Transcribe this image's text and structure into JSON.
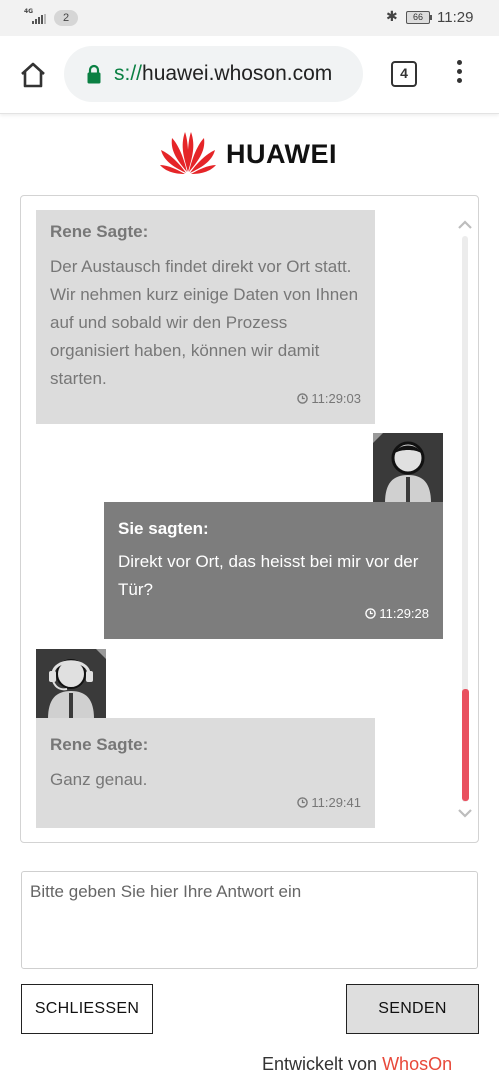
{
  "status_bar": {
    "network": "4G",
    "notification_count": "2",
    "battery": "66",
    "time": "11:29"
  },
  "browser": {
    "url_scheme": "s://",
    "url_host": "huawei.whoson.com",
    "tab_count": "4"
  },
  "logo": {
    "text": "HUAWEI",
    "brand_color": "#e52528"
  },
  "chat": {
    "messages": [
      {
        "author": "Rene Sagte:",
        "text": "Der Austausch findet direkt vor Ort statt. Wir nehmen kurz einige Daten von Ihnen auf und sobald wir den Prozess organisiert haben, können wir damit starten.",
        "time": "11:29:03",
        "sender": "agent"
      },
      {
        "author": "Sie sagten:",
        "text": "Direkt vor Ort, das heisst bei mir vor der Tür?",
        "time": "11:29:28",
        "sender": "user"
      },
      {
        "author": "Rene Sagte:",
        "text": "Ganz genau.",
        "time": "11:29:41",
        "sender": "agent"
      }
    ],
    "scroll_position": 0.9,
    "scrollbar_color": "#e9505f"
  },
  "reply": {
    "placeholder": "Bitte geben Sie hier Ihre Antwort ein"
  },
  "buttons": {
    "close_label": "SCHLIESSEN",
    "send_label": "SENDEN"
  },
  "footer": {
    "prefix": "Entwickelt von ",
    "brand": "WhosOn",
    "brand_color": "#e8493a"
  }
}
